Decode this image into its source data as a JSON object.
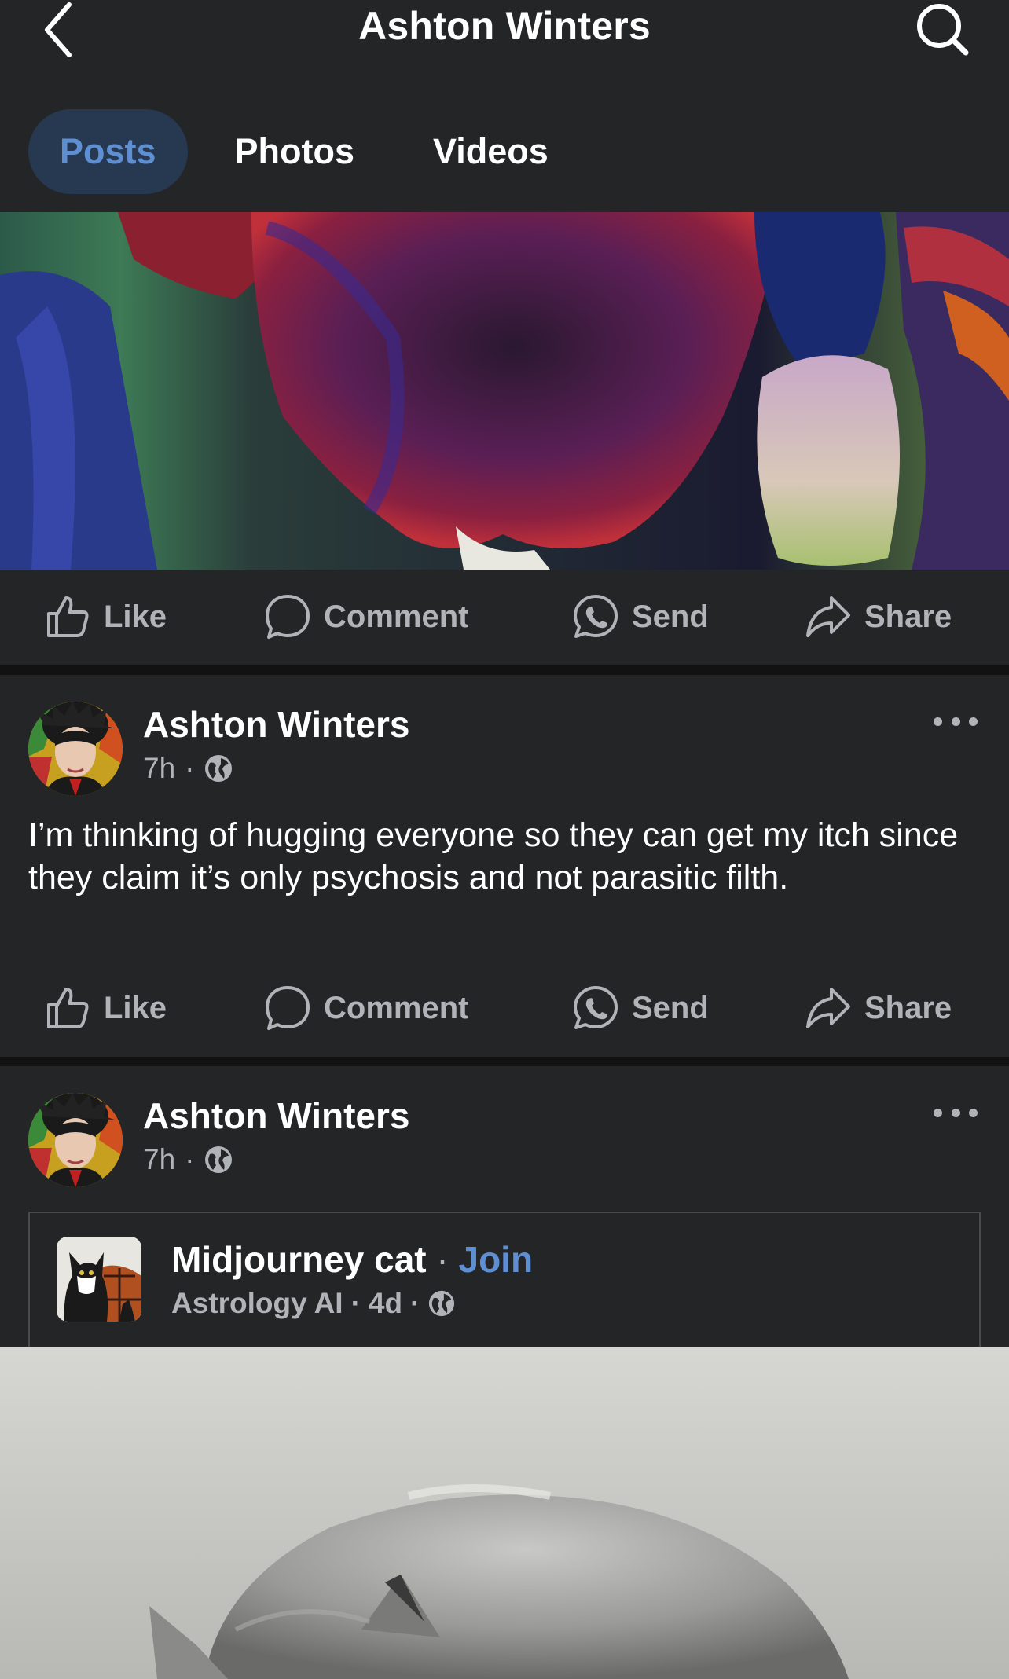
{
  "header": {
    "title": "Ashton Winters",
    "back_icon": "chevron-left-icon",
    "search_icon": "search-icon"
  },
  "tabs": [
    {
      "label": "Posts",
      "active": true
    },
    {
      "label": "Photos",
      "active": false
    },
    {
      "label": "Videos",
      "active": false
    }
  ],
  "actions": {
    "like": "Like",
    "comment": "Comment",
    "send": "Send",
    "share": "Share"
  },
  "posts": [
    {
      "author": "Ashton Winters",
      "time": "7h",
      "separator": "·",
      "text": "I’m thinking of hugging everyone so they can get my itch since they claim it’s only psychosis and not parasitic filth."
    },
    {
      "author": "Ashton Winters",
      "time": "7h",
      "separator": "·",
      "shared": {
        "group_name": "Midjourney cat",
        "separator": "·",
        "join_label": "Join",
        "subtitle": "Astrology AI",
        "age": "4d"
      }
    }
  ],
  "colors": {
    "background": "#242527",
    "accent": "#5f8fd3",
    "active_tab_bg": "#263951",
    "muted_text": "#b0b3b8"
  }
}
